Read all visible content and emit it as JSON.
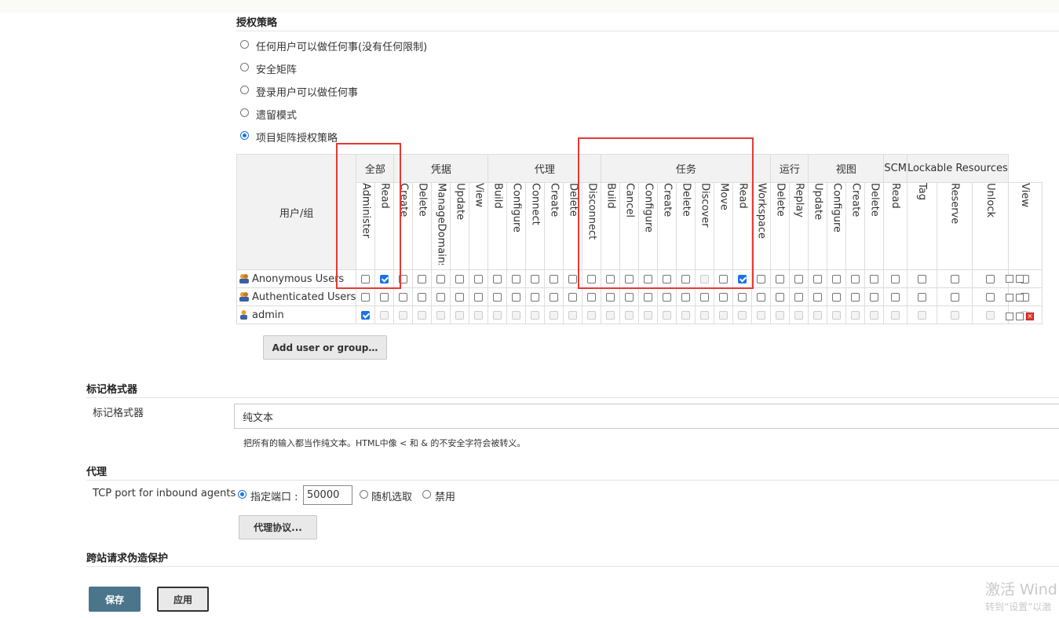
{
  "auth": {
    "title": "授权策略",
    "options": [
      {
        "label": "任何用户可以做任何事(没有任何限制)",
        "selected": false
      },
      {
        "label": "安全矩阵",
        "selected": false
      },
      {
        "label": "登录用户可以做任何事",
        "selected": false
      },
      {
        "label": "遗留模式",
        "selected": false
      },
      {
        "label": "项目矩阵授权策略",
        "selected": true
      }
    ]
  },
  "matrix": {
    "user_header": "用户/组",
    "groups": [
      "全部",
      "凭据",
      "代理",
      "任务",
      "运行",
      "视图",
      "SCM",
      "Lockable Resources"
    ],
    "permissions": [
      "Administer",
      "Read",
      "Create",
      "Delete",
      "ManageDomains",
      "Update",
      "View",
      "Build",
      "Configure",
      "Connect",
      "Create",
      "Delete",
      "Disconnect",
      "Build",
      "Cancel",
      "Configure",
      "Create",
      "Delete",
      "Discover",
      "Move",
      "Read",
      "Workspace",
      "Delete",
      "Replay",
      "Update",
      "Configure",
      "Create",
      "Delete",
      "Read",
      "Tag",
      "Reserve",
      "Unlock",
      "View"
    ],
    "rows": [
      {
        "name": "Anonymous Users",
        "icon": "group-icon",
        "checked": [
          1,
          20
        ],
        "disabled": [
          18
        ]
      },
      {
        "name": "Authenticated Users",
        "icon": "group-icon",
        "checked": [],
        "disabled": []
      },
      {
        "name": "admin",
        "icon": "user-icon",
        "checked": [
          0
        ],
        "disabled": "others"
      }
    ],
    "add_button": "Add user or group…"
  },
  "markup": {
    "title": "标记格式器",
    "field_label": "标记格式器",
    "value": "纯文本",
    "help": "把所有的输入都当作纯文本。HTML中像 < 和 & 的不安全字符会被转义。"
  },
  "agent": {
    "title": "代理",
    "tcp_label": "TCP port for inbound agents",
    "fixed_label": "指定端口 :",
    "port": "50000",
    "random_label": "随机选取",
    "disable_label": "禁用",
    "protocols_button": "代理协议..."
  },
  "csrf": {
    "title": "跨站请求伪造保护"
  },
  "actions": {
    "save": "保存",
    "apply": "应用"
  },
  "watermark": {
    "line1": "激活 Wind",
    "line2": "转到“设置”以激"
  },
  "colors": {
    "accent": "#1a73e8",
    "highlight": "#e53935",
    "save_bg": "#4b758b"
  }
}
